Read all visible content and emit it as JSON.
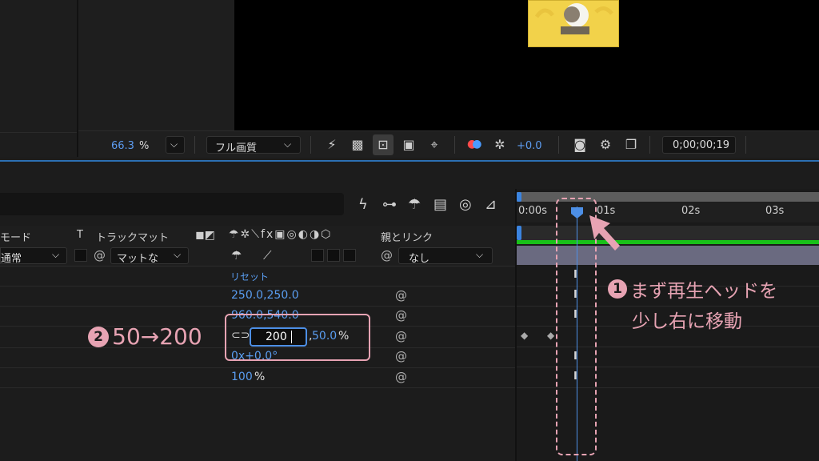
{
  "viewer": {
    "zoom_value": "66.3",
    "zoom_unit": "%",
    "resolution": "フル画質",
    "exposure": "+0.0",
    "timecode": "0;00;00;19"
  },
  "timeline": {
    "ruler_labels": [
      "0:00s",
      "01s",
      "02s",
      "03s"
    ],
    "columns": {
      "mode": "モード",
      "t": "T",
      "track_matte": "トラックマット",
      "parent_link": "親とリンク"
    },
    "layer": {
      "mode_value": "通常",
      "matte_value": "マットな",
      "parent_value": "なし"
    },
    "properties": {
      "reset": "リセット",
      "anchor": "250.0,250.0",
      "position": "960.0,540.0",
      "scale_x": "200",
      "scale_y": "50.0",
      "scale_unit": "%",
      "rotation": "0x+0.0°",
      "opacity_value": "100",
      "opacity_unit": "%"
    }
  },
  "annotations": {
    "step1_num": "1",
    "step1_line1": "まず再生ヘッドを",
    "step1_line2": "少し右に移動",
    "step2_num": "2",
    "step2_text": "50→200"
  },
  "colors": {
    "accent_blue": "#5a9ef2",
    "annotation_pink": "#e7a3b3",
    "layer_bar_green": "#19c019",
    "preview_yellow": "#f2d24a"
  }
}
